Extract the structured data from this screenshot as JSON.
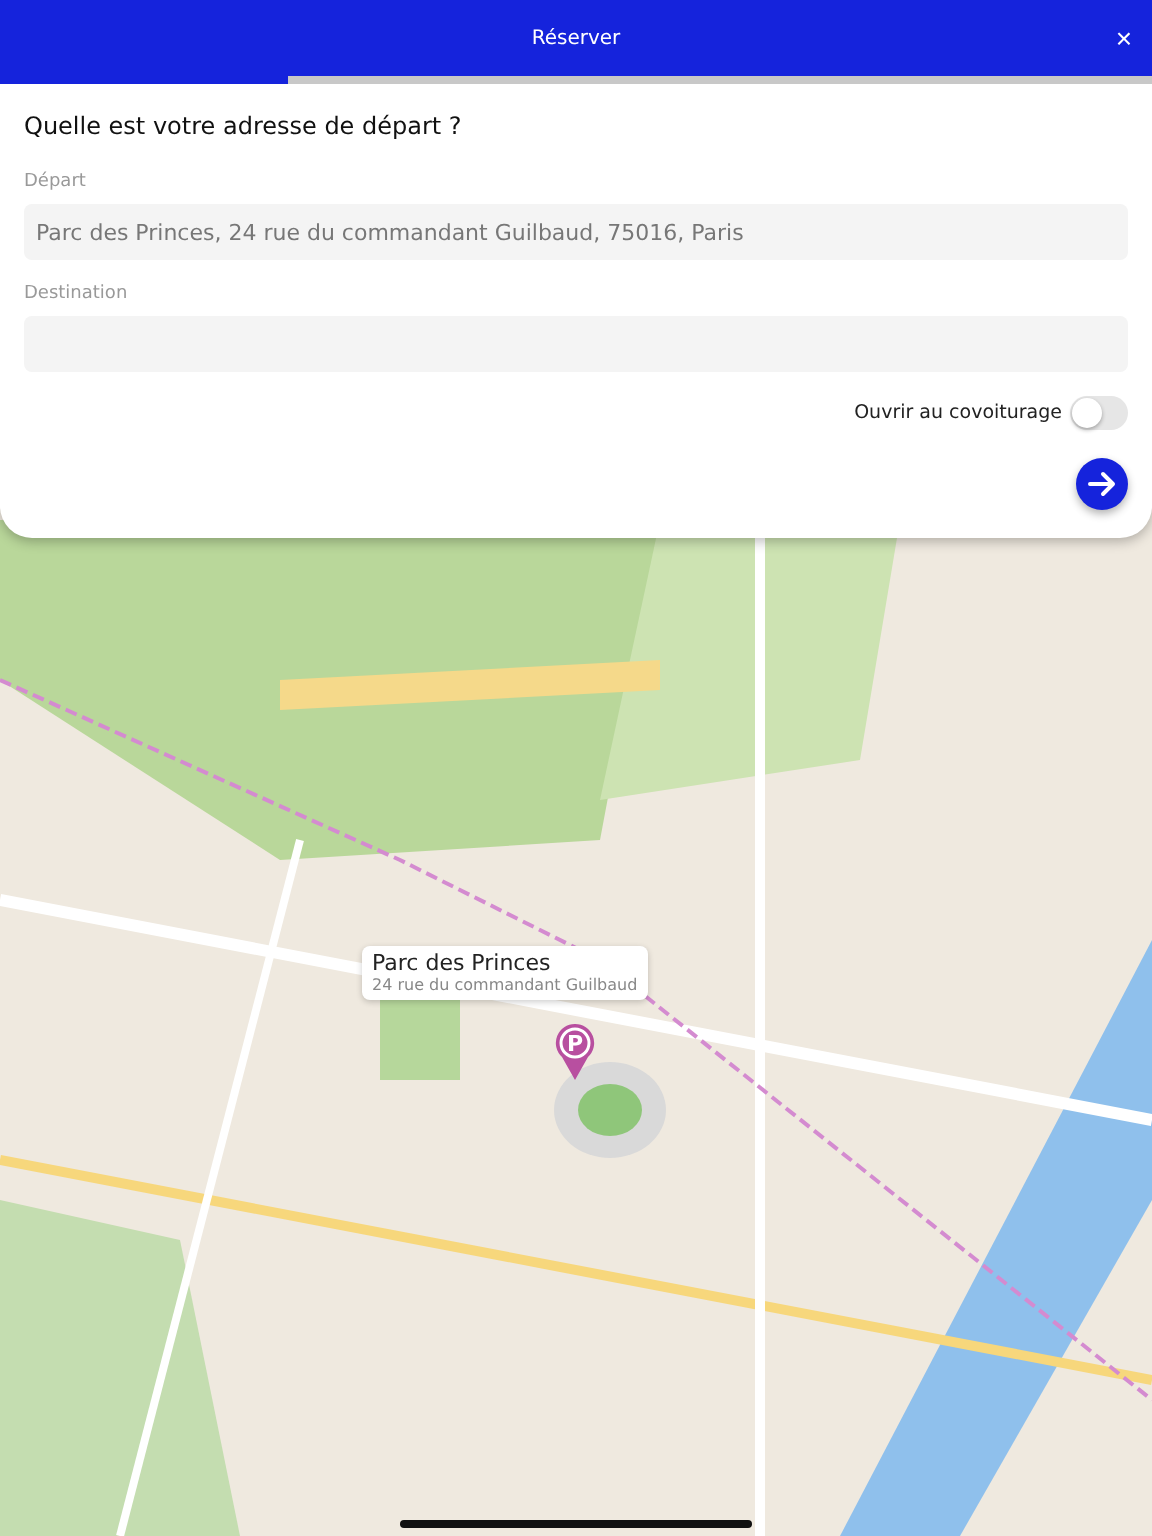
{
  "header": {
    "title": "Réserver",
    "close": "×"
  },
  "progress": {
    "level": 0.25
  },
  "form": {
    "question": "Quelle est votre adresse de départ ?",
    "fields": [
      {
        "label": "Départ",
        "value": "Parc des Princes, 24 rue du commandant Guilbaud, 75016, Paris"
      },
      {
        "label": "Destination"
      }
    ],
    "toggle": {
      "label": "Ouvrir au covoiturage",
      "on": false
    }
  },
  "map": {
    "kind": "picture",
    "callout": {
      "title": "Parc des Princes",
      "subtitle": "24 rue du commandant Guilbaud"
    },
    "pin": {
      "glyph": "P"
    }
  }
}
